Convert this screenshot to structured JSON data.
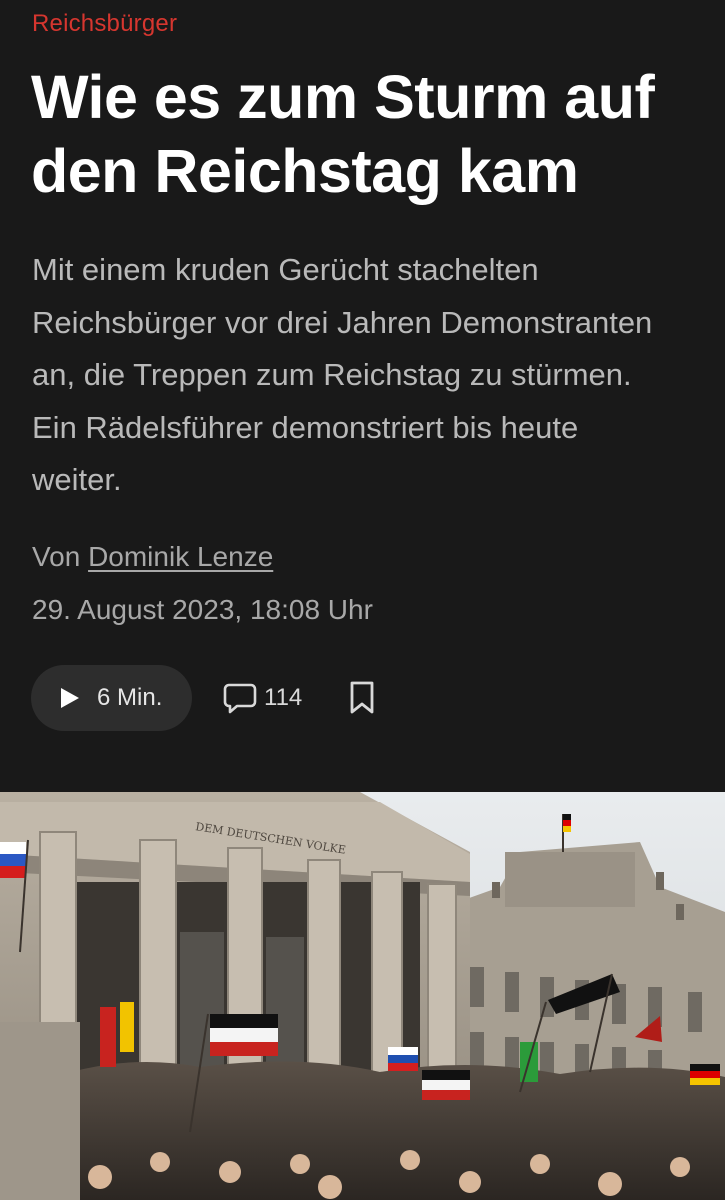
{
  "article": {
    "kicker": "Reichsbürger",
    "headline": "Wie es zum Sturm auf den Reichstag kam",
    "teaser": "Mit einem kruden Gerücht stachelten Reichsbürger vor drei Jahren Demonstranten an, die Treppen zum Reichstag zu stürmen. Ein Rädelsführer demonstriert bis heute weiter.",
    "byline_prefix": "Von",
    "author": "Dominik Lenze",
    "date": "29. August 2023, 18:08 Uhr"
  },
  "actions": {
    "listen_label": "6 Min.",
    "listen_icon": "play-icon",
    "comment_count": "114",
    "comment_icon": "speech-bubble-icon",
    "bookmark_icon": "bookmark-icon"
  },
  "image": {
    "frieze_inscription": "DEM DEUTSCHEN VOLKE"
  },
  "colors": {
    "background": "#191919",
    "kicker": "#d6362f",
    "headline": "#ffffff",
    "teaser": "#b9b9b9",
    "meta": "#a8a8a8",
    "button_bg": "#2d2d2d"
  }
}
